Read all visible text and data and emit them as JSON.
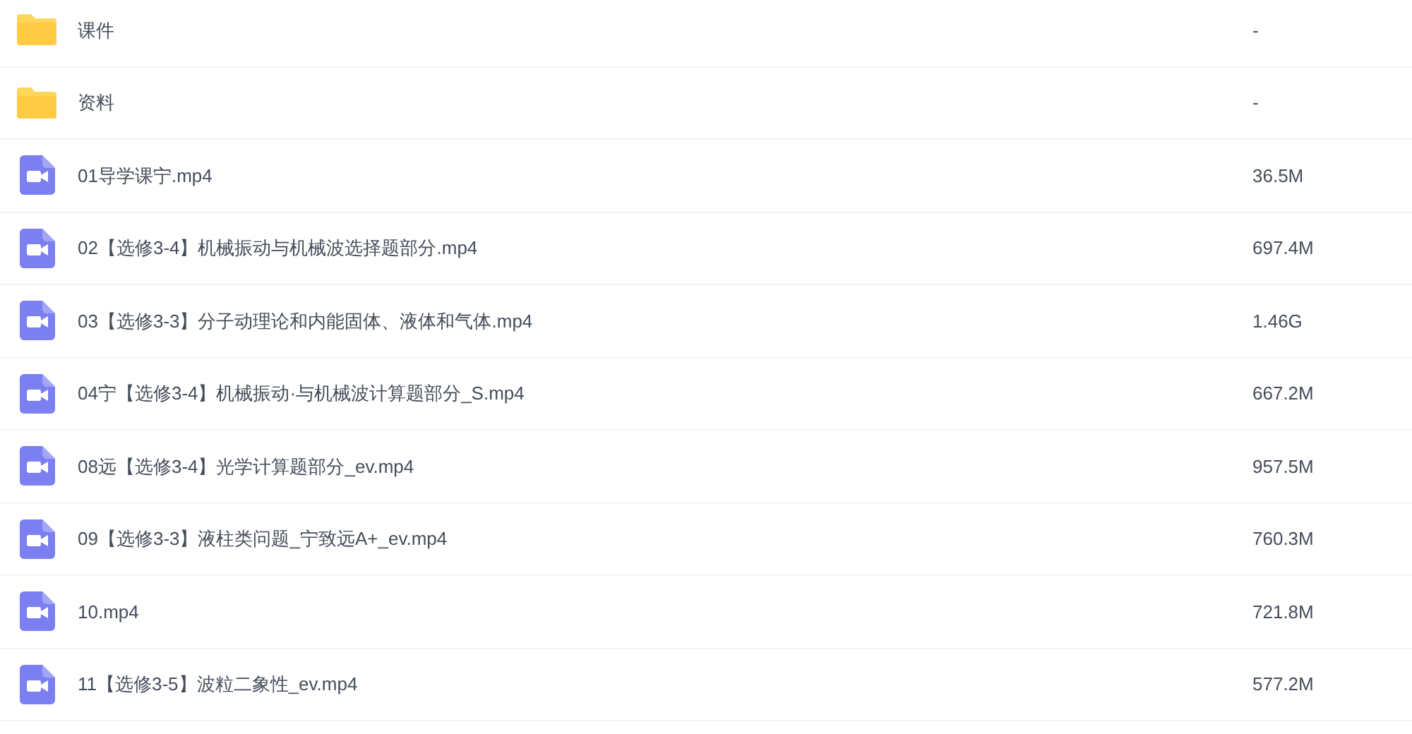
{
  "files": [
    {
      "kind": "folder",
      "name": "课件",
      "size": "-"
    },
    {
      "kind": "folder",
      "name": "资料",
      "size": "-"
    },
    {
      "kind": "video",
      "name": "01导学课宁.mp4",
      "size": "36.5M"
    },
    {
      "kind": "video",
      "name": "02【选修3-4】机械振动与机械波选择题部分.mp4",
      "size": "697.4M"
    },
    {
      "kind": "video",
      "name": "03【选修3-3】分子动理论和内能固体、液体和气体.mp4",
      "size": "1.46G"
    },
    {
      "kind": "video",
      "name": "04宁【选修3-4】机械振动·与机械波计算题部分_S.mp4",
      "size": "667.2M"
    },
    {
      "kind": "video",
      "name": "08远【选修3-4】光学计算题部分_ev.mp4",
      "size": "957.5M"
    },
    {
      "kind": "video",
      "name": "09【选修3-3】液柱类问题_宁致远A+_ev.mp4",
      "size": "760.3M"
    },
    {
      "kind": "video",
      "name": "10.mp4",
      "size": "721.8M"
    },
    {
      "kind": "video",
      "name": "11【选修3-5】波粒二象性_ev.mp4",
      "size": "577.2M"
    }
  ]
}
